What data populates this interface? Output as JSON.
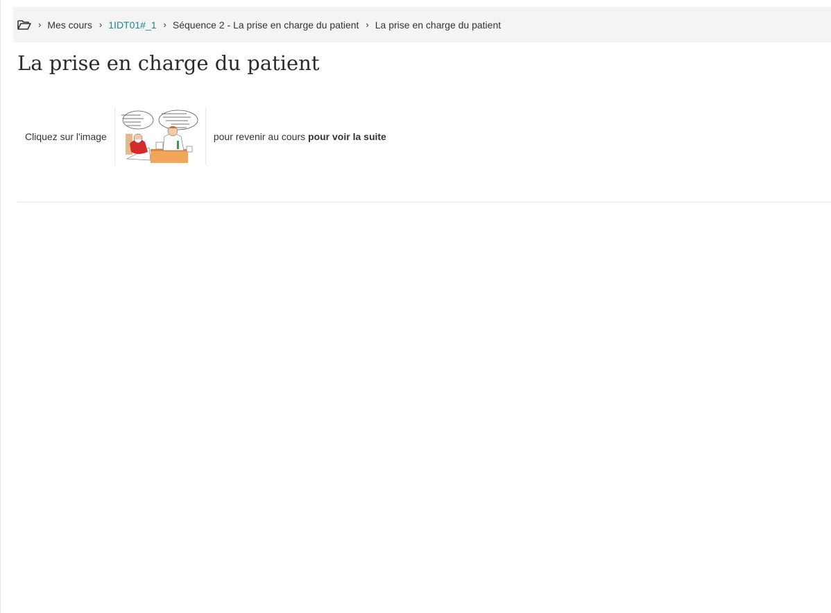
{
  "breadcrumb": {
    "home_icon": "folder-open-icon",
    "items": [
      {
        "label": "Mes cours"
      },
      {
        "label": "1IDT01#_1"
      },
      {
        "label": "Séquence 2 - La prise en charge du patient"
      },
      {
        "label": "La prise en charge du patient"
      }
    ]
  },
  "page": {
    "title": "La prise en charge du patient"
  },
  "content": {
    "text_before": "Cliquez sur l'image",
    "text_after": "pour revenir au cours",
    "text_bold": "pour voir la suite",
    "image_icon": "cartoon-image"
  },
  "colors": {
    "link": "#1a8a8a",
    "breadcrumb_bg": "#f4f4f4"
  }
}
